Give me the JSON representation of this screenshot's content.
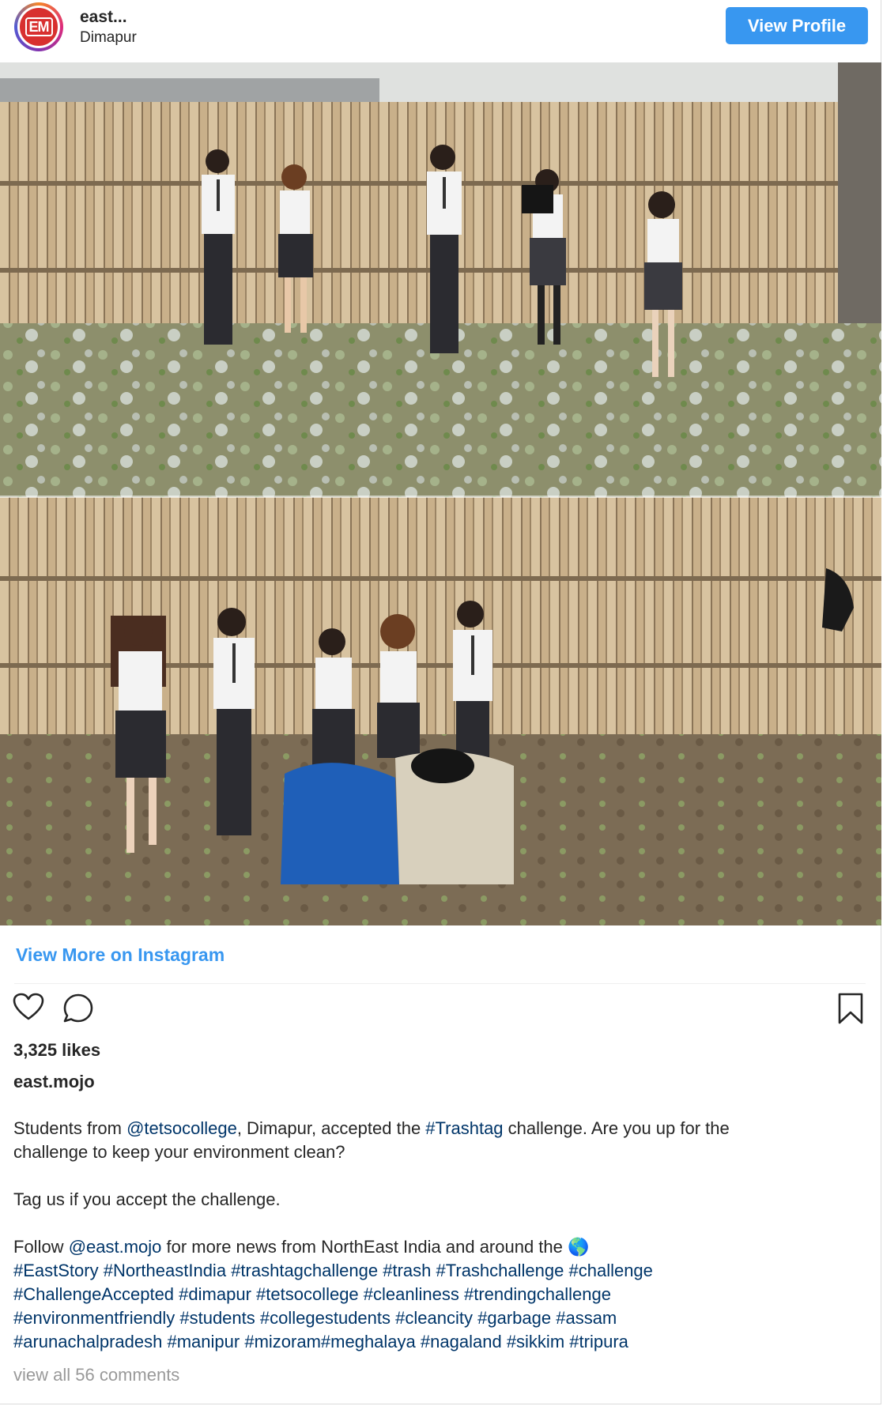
{
  "header": {
    "username": "east...",
    "location": "Dimapur",
    "avatar_text": "EM",
    "view_profile": "View Profile"
  },
  "media": {
    "view_more": "View More on Instagram"
  },
  "actions": {
    "like_icon": "heart-icon",
    "comment_icon": "comment-icon",
    "save_icon": "bookmark-icon"
  },
  "likes": "3,325 likes",
  "author": "east.mojo",
  "caption": {
    "line1": [
      {
        "t": "Students from "
      },
      {
        "t": "@tetsocollege",
        "link": true
      },
      {
        "t": ", Dimapur, accepted the "
      },
      {
        "t": "#Trashtag",
        "link": true
      },
      {
        "t": " challenge. Are you up for the"
      }
    ],
    "line2": [
      {
        "t": "challenge to keep your environment clean?"
      }
    ],
    "line3": [
      {
        "t": "Tag us if you accept the challenge."
      }
    ],
    "line4": [
      {
        "t": "Follow "
      },
      {
        "t": "@east.mojo",
        "link": true
      },
      {
        "t": " for more news from NorthEast India and around the 🌎"
      }
    ],
    "line5": [
      {
        "t": "#EastStory",
        "link": true
      },
      {
        "t": " "
      },
      {
        "t": "#NortheastIndia",
        "link": true
      },
      {
        "t": " "
      },
      {
        "t": "#trashtagchallenge",
        "link": true
      },
      {
        "t": " "
      },
      {
        "t": "#trash",
        "link": true
      },
      {
        "t": " "
      },
      {
        "t": "#Trashchallenge",
        "link": true
      },
      {
        "t": " "
      },
      {
        "t": "#challenge",
        "link": true
      }
    ],
    "line6": [
      {
        "t": "#ChallengeAccepted",
        "link": true
      },
      {
        "t": " "
      },
      {
        "t": "#dimapur",
        "link": true
      },
      {
        "t": " "
      },
      {
        "t": "#tetsocollege",
        "link": true
      },
      {
        "t": " "
      },
      {
        "t": "#cleanliness",
        "link": true
      },
      {
        "t": " "
      },
      {
        "t": "#trendingchallenge",
        "link": true
      }
    ],
    "line7": [
      {
        "t": "#environmentfriendly",
        "link": true
      },
      {
        "t": " "
      },
      {
        "t": "#students",
        "link": true
      },
      {
        "t": " "
      },
      {
        "t": "#collegestudents",
        "link": true
      },
      {
        "t": " "
      },
      {
        "t": "#cleancity",
        "link": true
      },
      {
        "t": " "
      },
      {
        "t": "#garbage",
        "link": true
      },
      {
        "t": " "
      },
      {
        "t": "#assam",
        "link": true
      }
    ],
    "line8": [
      {
        "t": "#arunachalpradesh",
        "link": true
      },
      {
        "t": " "
      },
      {
        "t": "#manipur",
        "link": true
      },
      {
        "t": " "
      },
      {
        "t": "#mizoram#meghalaya",
        "link": true
      },
      {
        "t": " "
      },
      {
        "t": "#nagaland",
        "link": true
      },
      {
        "t": " "
      },
      {
        "t": "#sikkim",
        "link": true
      },
      {
        "t": " "
      },
      {
        "t": "#tripura",
        "link": true
      }
    ]
  },
  "comments": "view all 56 comments"
}
